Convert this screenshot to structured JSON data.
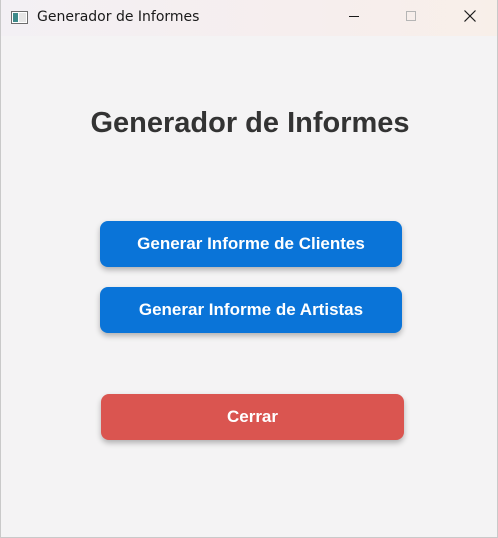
{
  "window": {
    "title": "Generador de Informes",
    "icon": "app-window-icon",
    "controls": [
      "minimize-icon",
      "maximize-icon",
      "close-icon"
    ]
  },
  "main": {
    "heading": "Generador de Informes",
    "buttons": {
      "clientes": "Generar Informe de Clientes",
      "artistas": "Generar Informe de Artistas",
      "cerrar": "Cerrar"
    }
  },
  "colors": {
    "background": "#f4f3f4",
    "primary_button": "#0a74d8",
    "close_button": "#da5550",
    "heading_text": "#333333"
  }
}
